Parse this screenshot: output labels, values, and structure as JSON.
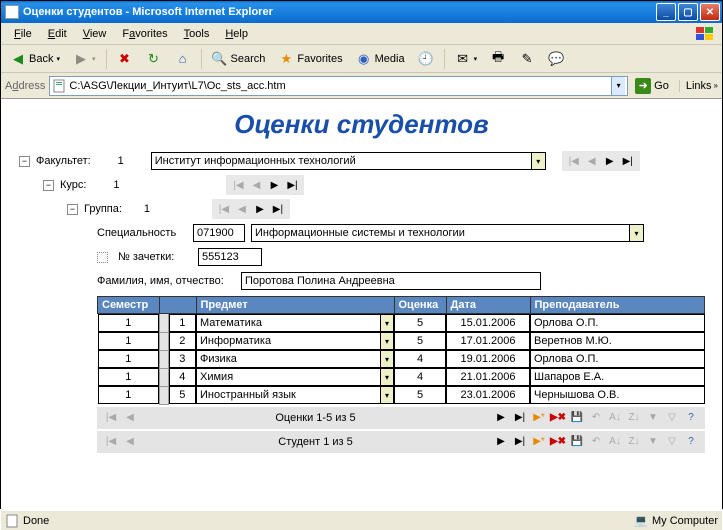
{
  "window": {
    "title": "Оценки студентов - Microsoft Internet Explorer"
  },
  "menu": {
    "file": "File",
    "edit": "Edit",
    "view": "View",
    "favorites": "Favorites",
    "tools": "Tools",
    "help": "Help"
  },
  "toolbar": {
    "back": "Back",
    "search": "Search",
    "favorites": "Favorites",
    "media": "Media"
  },
  "address": {
    "label": "Address",
    "value": "C:\\ASG\\Лекции_Интуит\\L7\\Oc_sts_acc.htm",
    "go": "Go",
    "links": "Links"
  },
  "page": {
    "title": "Оценки студентов",
    "faculty_label": "Факультет:",
    "faculty_num": "1",
    "faculty_name": "Институт информационных технологий",
    "course_label": "Курс:",
    "course_num": "1",
    "group_label": "Группа:",
    "group_num": "1",
    "spec_label": "Специальность",
    "spec_code": "071900",
    "spec_name": "Информационные системы и технологии",
    "zach_label": "№ зачетки:",
    "zach_val": "555123",
    "fio_label": "Фамилия, имя, отчество:",
    "fio_val": "Поротова Полина Андреевна",
    "headers": {
      "sem": "Семестр",
      "subj": "Предмет",
      "grade": "Оценка",
      "date": "Дата",
      "teacher": "Преподаватель"
    },
    "rows": [
      {
        "sem": "1",
        "n": "1",
        "subj": "Математика",
        "grade": "5",
        "date": "15.01.2006",
        "teacher": "Орлова О.П."
      },
      {
        "sem": "1",
        "n": "2",
        "subj": "Информатика",
        "grade": "5",
        "date": "17.01.2006",
        "teacher": "Веретнов М.Ю."
      },
      {
        "sem": "1",
        "n": "3",
        "subj": "Физика",
        "grade": "4",
        "date": "19.01.2006",
        "teacher": "Орлова О.П."
      },
      {
        "sem": "1",
        "n": "4",
        "subj": "Химия",
        "grade": "4",
        "date": "21.01.2006",
        "teacher": "Шапаров Е.А."
      },
      {
        "sem": "1",
        "n": "5",
        "subj": "Иностранный язык",
        "grade": "5",
        "date": "23.01.2006",
        "teacher": "Чернышова О.В."
      }
    ],
    "paging1": "Оценки 1-5 из 5",
    "paging2": "Студент 1 из 5"
  },
  "status": {
    "done": "Done",
    "zone": "My Computer"
  }
}
